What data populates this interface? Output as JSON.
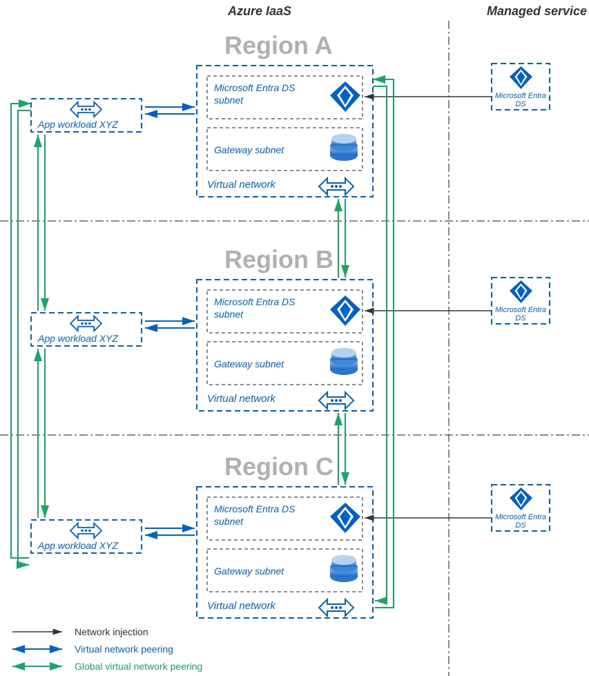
{
  "headers": {
    "iaas": "Azure IaaS",
    "managed": "Managed service"
  },
  "regions": {
    "a": {
      "title": "Region A",
      "entra": "Microsoft Entra DS subnet",
      "gateway": "Gateway subnet",
      "vnet": "Virtual network"
    },
    "b": {
      "title": "Region B",
      "entra": "Microsoft Entra DS subnet",
      "gateway": "Gateway subnet",
      "vnet": "Virtual network"
    },
    "c": {
      "title": "Region C",
      "entra": "Microsoft Entra DS subnet",
      "gateway": "Gateway subnet",
      "vnet": "Virtual network"
    }
  },
  "app": {
    "a": "App workload XYZ",
    "b": "App workload XYZ",
    "c": "App workload XYZ"
  },
  "managed": {
    "a": "Microsoft Entra DS",
    "b": "Microsoft Entra DS",
    "c": "Microsoft Entra DS"
  },
  "legend": {
    "injection": "Network injection",
    "peering": "Virtual network peering",
    "global": "Global virtual network peering"
  },
  "colors": {
    "blue": "#0062c7",
    "green": "#18a664",
    "dashed": "#5a6873",
    "grey": "#333"
  }
}
